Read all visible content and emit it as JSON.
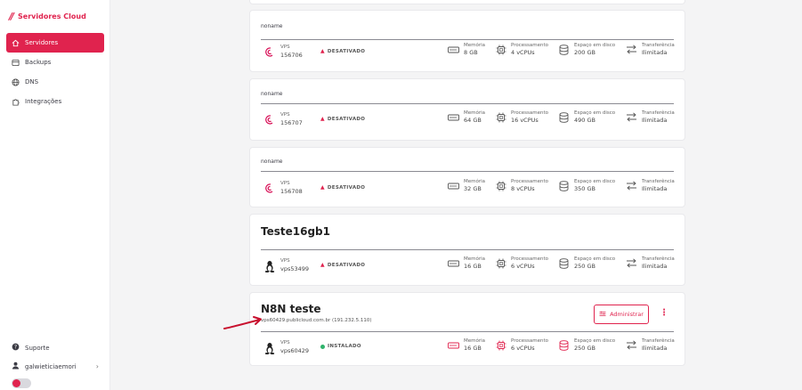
{
  "brand": {
    "name": "Servidores Cloud"
  },
  "sidebar": {
    "items": [
      {
        "label": "Servidores",
        "icon": "home-icon",
        "active": true
      },
      {
        "label": "Backups",
        "icon": "backups-icon",
        "active": false
      },
      {
        "label": "DNS",
        "icon": "globe-icon",
        "active": false
      },
      {
        "label": "Integrações",
        "icon": "puzzle-icon",
        "active": false
      }
    ],
    "support": "Suporte",
    "user": "galwieticiaemori"
  },
  "labels": {
    "memory": "Memória",
    "cpu": "Processamento",
    "disk": "Espaço em disco",
    "transfer": "Transferência",
    "transfer_value": "Ilimitada",
    "type": "VPS"
  },
  "servers": [
    {
      "name": "noname",
      "os": "debian-icon",
      "id": "156706",
      "status": "DESATIVADO",
      "memory": "8 GB",
      "cpu": "4 vCPUs",
      "disk": "200 GB"
    },
    {
      "name": "noname",
      "os": "debian-icon",
      "id": "156707",
      "status": "DESATIVADO",
      "memory": "64 GB",
      "cpu": "16 vCPUs",
      "disk": "490 GB"
    },
    {
      "name": "noname",
      "os": "debian-icon",
      "id": "156708",
      "status": "DESATIVADO",
      "memory": "32 GB",
      "cpu": "8 vCPUs",
      "disk": "350 GB"
    },
    {
      "name": "Teste16gb1",
      "os": "linux-icon",
      "id": "vps53499",
      "status": "DESATIVADO",
      "memory": "16 GB",
      "cpu": "6 vCPUs",
      "disk": "250 GB"
    },
    {
      "name": "N8N teste",
      "os": "linux-icon",
      "id": "vps60429",
      "status": "INSTALADO",
      "host": "vps60429.publicloud.com.br (191.232.5.110)",
      "memory": "16 GB",
      "cpu": "6 vCPUs",
      "disk": "250 GB",
      "action": "Administrar"
    }
  ],
  "colors": {
    "accent": "#e0234e",
    "installed": "#2fb36b"
  }
}
